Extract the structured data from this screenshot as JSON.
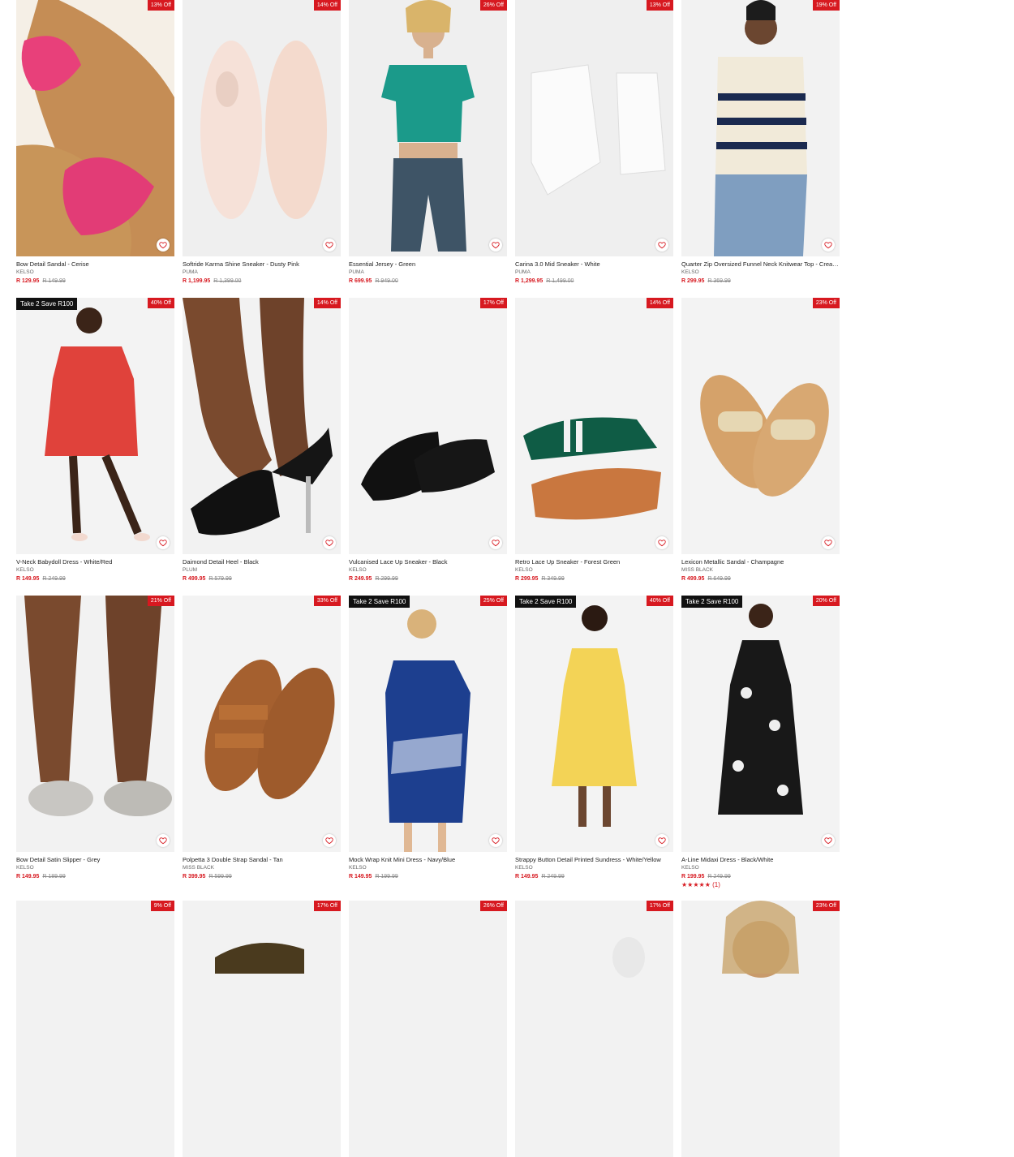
{
  "products": [
    {
      "name": "Bow Detail Sandal - Cerise",
      "brand": "KELSO",
      "price": "R 129.95",
      "was": "R 149.99",
      "discount": "13% Off",
      "promo": "",
      "bg": "#c99a63",
      "art": "sandal-pink"
    },
    {
      "name": "Softride Karma Shine Sneaker - Dusty Pink",
      "brand": "PUMA",
      "price": "R 1,199.95",
      "was": "R 1,399.00",
      "discount": "14% Off",
      "promo": "",
      "bg": "#efefef",
      "art": "sneaker-pink"
    },
    {
      "name": "Essential Jersey - Green",
      "brand": "PUMA",
      "price": "R 699.95",
      "was": "R 949.00",
      "discount": "26% Off",
      "promo": "",
      "bg": "#f0f0f0",
      "art": "jersey-green"
    },
    {
      "name": "Carina 3.0 Mid Sneaker - White",
      "brand": "PUMA",
      "price": "R 1,299.95",
      "was": "R 1,499.00",
      "discount": "13% Off",
      "promo": "",
      "bg": "#f0f0f0",
      "art": "sneaker-white"
    },
    {
      "name": "Quarter Zip Oversized Funnel Neck Knitwear Top - Cream/...",
      "brand": "KELSO",
      "price": "R 299.95",
      "was": "R 369.99",
      "discount": "19% Off",
      "promo": "",
      "bg": "#f2f2f2",
      "art": "knit-top"
    },
    {
      "name": "V-Neck Babydoll Dress - White/Red",
      "brand": "KELSO",
      "price": "R 149.95",
      "was": "R 249.99",
      "discount": "40% Off",
      "promo": "Take 2 Save R100",
      "bg": "#f3f3f3",
      "art": "dress-red"
    },
    {
      "name": "Daimond Detail Heel - Black",
      "brand": "PLUM",
      "price": "R 499.95",
      "was": "R 579.99",
      "discount": "14% Off",
      "promo": "",
      "bg": "#f2f2f2",
      "art": "heel-black"
    },
    {
      "name": "Vulcanised Lace Up Sneaker - Black",
      "brand": "KELSO",
      "price": "R 249.95",
      "was": "R 299.99",
      "discount": "17% Off",
      "promo": "",
      "bg": "#f3f3f3",
      "art": "sneaker-black"
    },
    {
      "name": "Retro Lace Up Sneaker - Forest Green",
      "brand": "KELSO",
      "price": "R 299.95",
      "was": "R 349.99",
      "discount": "14% Off",
      "promo": "",
      "bg": "#f3f3f3",
      "art": "sneaker-green"
    },
    {
      "name": "Lexicon Metallic Sandal - Champagne",
      "brand": "MISS BLACK",
      "price": "R 499.95",
      "was": "R 649.99",
      "discount": "23% Off",
      "promo": "",
      "bg": "#f3f3f3",
      "art": "sandal-gold"
    },
    {
      "name": "Bow Detail Satin Slipper - Grey",
      "brand": "KELSO",
      "price": "R 149.95",
      "was": "R 189.99",
      "discount": "21% Off",
      "promo": "",
      "bg": "#f2f2f2",
      "art": "slipper-grey"
    },
    {
      "name": "Polpetta 3 Double Strap Sandal - Tan",
      "brand": "MISS BLACK",
      "price": "R 399.95",
      "was": "R 599.99",
      "discount": "33% Off",
      "promo": "",
      "bg": "#f3f3f3",
      "art": "sandal-tan"
    },
    {
      "name": "Mock Wrap Knit Mini Dress - Navy/Blue",
      "brand": "KELSO",
      "price": "R 149.95",
      "was": "R 199.99",
      "discount": "25% Off",
      "promo": "Take 2 Save R100",
      "bg": "#f3f3f3",
      "art": "dress-blue"
    },
    {
      "name": "Strappy Button Detail Printed Sundress - White/Yellow",
      "brand": "KELSO",
      "price": "R 149.95",
      "was": "R 249.99",
      "discount": "40% Off",
      "promo": "Take 2 Save R100",
      "bg": "#f3f3f3",
      "art": "dress-yellow"
    },
    {
      "name": "A-Line Midaxi Dress - Black/White",
      "brand": "KELSO",
      "price": "R 199.95",
      "was": "R 249.99",
      "discount": "20% Off",
      "promo": "Take 2 Save R100",
      "bg": "#f3f3f3",
      "art": "dress-black",
      "rating": "★★★★★",
      "reviews": "(1)"
    },
    {
      "name": "",
      "brand": "",
      "price": "",
      "was": "",
      "discount": "9% Off",
      "promo": "",
      "bg": "#f2f2f2",
      "art": "blank"
    },
    {
      "name": "",
      "brand": "",
      "price": "",
      "was": "",
      "discount": "17% Off",
      "promo": "",
      "bg": "#f2f2f2",
      "art": "partial-shoe"
    },
    {
      "name": "",
      "brand": "",
      "price": "",
      "was": "",
      "discount": "26% Off",
      "promo": "",
      "bg": "#f2f2f2",
      "art": "blank"
    },
    {
      "name": "",
      "brand": "",
      "price": "",
      "was": "",
      "discount": "17% Off",
      "promo": "",
      "bg": "#f2f2f2",
      "art": "partial-white"
    },
    {
      "name": "",
      "brand": "",
      "price": "",
      "was": "",
      "discount": "23% Off",
      "promo": "",
      "bg": "#f2f2f2",
      "art": "partial-woman"
    }
  ],
  "colors": {
    "sale_red": "#d71920",
    "promo_black": "#111111"
  },
  "icons": {
    "wishlist": "heart-icon"
  }
}
